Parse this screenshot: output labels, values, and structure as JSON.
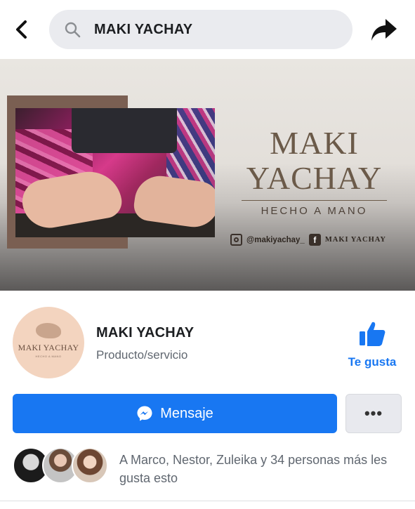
{
  "search": {
    "query": "MAKI YACHAY"
  },
  "cover": {
    "brand_line1": "MAKI",
    "brand_line2": "YACHAY",
    "tagline": "HECHO A MANO",
    "instagram_handle": "@makiyachay_",
    "facebook_name": "MAKI YACHAY"
  },
  "profile": {
    "avatar_text": "MAKI YACHAY",
    "avatar_subtext": "HECHO A MANO",
    "name": "MAKI YACHAY",
    "category": "Producto/servicio",
    "like_label": "Te gusta"
  },
  "actions": {
    "message_label": "Mensaje",
    "more_label": "•••"
  },
  "friends": {
    "text": "A Marco, Nestor, Zuleika y 34 personas más les gusta esto"
  },
  "colors": {
    "accent": "#1877f2",
    "search_bg": "#eaebef",
    "secondary_text": "#606770"
  }
}
